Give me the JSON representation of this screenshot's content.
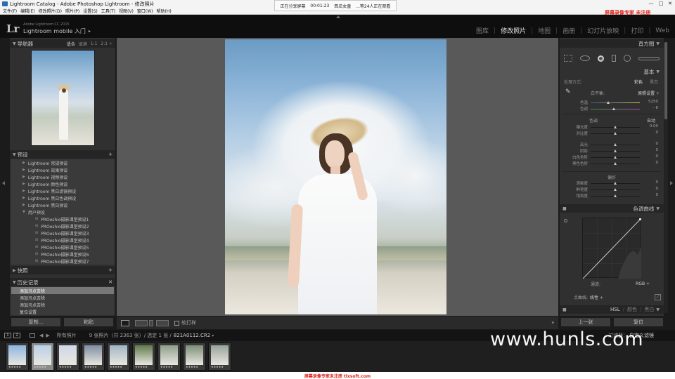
{
  "window": {
    "title": "Lightroom Catalog - Adobe Photoshop Lightroom - 修改照片",
    "minimize": "—",
    "maximize": "□",
    "close": "✕"
  },
  "menu": [
    "文件(F)",
    "编辑(E)",
    "修改照片(D)",
    "照片(P)",
    "设置(S)",
    "工具(T)",
    "视图(V)",
    "窗口(W)",
    "帮助(H)"
  ],
  "share": {
    "status": "正在分享屏幕",
    "time": "00:01:23",
    "host": "西瓜女童",
    "viewers": "...等24人正在观看"
  },
  "watermark_top": "屏幕录像专家 未注册",
  "identity": {
    "logo": "Lr",
    "product": "Adobe Lightroom CC 2015",
    "tagline": "Lightroom mobile 入门",
    "arrow": "▸"
  },
  "modules": [
    {
      "label": "图库",
      "active": false
    },
    {
      "label": "修改照片",
      "active": true
    },
    {
      "label": "地图",
      "active": false
    },
    {
      "label": "画册",
      "active": false
    },
    {
      "label": "幻灯片放映",
      "active": false
    },
    {
      "label": "打印",
      "active": false
    },
    {
      "label": "Web",
      "active": false
    }
  ],
  "navigator": {
    "title": "导航器",
    "zoom_options": [
      "适合",
      "填满",
      "1:1",
      "2:1 ÷"
    ]
  },
  "presets": {
    "title": "预设",
    "add": "+",
    "items": [
      {
        "label": "Lightroom 常规预设",
        "child": false
      },
      {
        "label": "Lightroom 效果预设",
        "child": false
      },
      {
        "label": "Lightroom 视频预设",
        "child": false
      },
      {
        "label": "Lightroom 颜色预设",
        "child": false
      },
      {
        "label": "Lightroom 黑白滤镜预设",
        "child": false
      },
      {
        "label": "Lightroom 黑白色调预设",
        "child": false
      },
      {
        "label": "Lightroom 黑白预设",
        "child": false
      },
      {
        "label": "用户预设",
        "child": false
      },
      {
        "label": "PROoshio摄影课堂预设1",
        "child": true
      },
      {
        "label": "PROoshio摄影课堂预设2",
        "child": true
      },
      {
        "label": "PROoshio摄影课堂预设3",
        "child": true
      },
      {
        "label": "PROoshio摄影课堂预设4",
        "child": true
      },
      {
        "label": "PROoshio摄影课堂预设5",
        "child": true
      },
      {
        "label": "PROoshio摄影课堂预设6",
        "child": true
      },
      {
        "label": "PROoshio摄影课堂预设7",
        "child": true
      }
    ]
  },
  "snapshots": {
    "title": "快照",
    "add": "+"
  },
  "history": {
    "title": "历史记录",
    "close": "✕",
    "items": [
      {
        "label": "添加污点去除",
        "active": true
      },
      {
        "label": "添加污点去除",
        "active": false
      },
      {
        "label": "添加污点去除",
        "active": false
      },
      {
        "label": "复位设置",
        "active": false
      }
    ]
  },
  "left_buttons": {
    "copy": "复制...",
    "paste": "粘贴"
  },
  "histogram": {
    "title": "直方图"
  },
  "basic": {
    "title": "基本",
    "treatment_label": "处理方式:",
    "color": "彩色",
    "bw": "黑白",
    "wb_label": "白平衡:",
    "wb_value": "原照设置 ÷",
    "temp_label": "色温",
    "temp_value": "5250",
    "temp_pos": 0.35,
    "tint_label": "色调",
    "tint_value": "- 6",
    "tint_pos": 0.47,
    "tone_label": "色调",
    "auto": "自动",
    "tone_sliders": [
      {
        "label": "曝光度",
        "value": "0.00",
        "pos": 0.5
      },
      {
        "label": "对比度",
        "value": "0",
        "pos": 0.5
      }
    ],
    "tone_sliders2": [
      {
        "label": "高光",
        "value": "0",
        "pos": 0.5
      },
      {
        "label": "阴影",
        "value": "0",
        "pos": 0.5
      },
      {
        "label": "白色色阶",
        "value": "0",
        "pos": 0.5
      },
      {
        "label": "黑色色阶",
        "value": "0",
        "pos": 0.5
      }
    ],
    "presence_label": "偏好",
    "presence_sliders": [
      {
        "label": "清晰度",
        "value": "0",
        "pos": 0.5
      },
      {
        "label": "鲜艳度",
        "value": "0",
        "pos": 0.5
      },
      {
        "label": "饱和度",
        "value": "0",
        "pos": 0.5
      }
    ]
  },
  "tone_curve": {
    "title": "色调曲线",
    "channel_label": "通道:",
    "channel_value": "RGB ÷",
    "point_curve_label": "点曲线:",
    "point_curve_value": "线性 ÷"
  },
  "hsl": {
    "tabs": [
      "HSL",
      "颜色",
      "黑白"
    ]
  },
  "right_buttons": {
    "prev": "上一张",
    "reset": "复位"
  },
  "toolbar": {
    "softproof": "软打样",
    "expand": "▾"
  },
  "filmbar": {
    "pages": [
      "1",
      "2"
    ],
    "source": "所有照片",
    "count": "9 张照片（共 2363 张）/ 选定 1 张 /",
    "filename": "821A0112.CR2",
    "filter_label": "过滤器：",
    "filter_value": "自定义滤镜"
  },
  "thumbnails": [
    {
      "stars": "★★★★★",
      "selected": false,
      "tone": "#8cb5de"
    },
    {
      "stars": "★★★★★",
      "selected": true,
      "tone": "#b9d0e6"
    },
    {
      "stars": "★★★★★",
      "selected": false,
      "tone": "#cfd8e6"
    },
    {
      "stars": "★★★★★",
      "selected": false,
      "tone": "#7e8da0"
    },
    {
      "stars": "★★★★★",
      "selected": false,
      "tone": "#a2b6c4"
    },
    {
      "stars": "★★★★★",
      "selected": false,
      "tone": "#5f7a4e"
    },
    {
      "stars": "★★★★★",
      "selected": false,
      "tone": "#8ea08a"
    },
    {
      "stars": "★★★★★",
      "selected": false,
      "tone": "#7b8f76"
    },
    {
      "stars": "★★★★★",
      "selected": false,
      "tone": "#98a39a"
    }
  ],
  "hunls": "www.hunls.com",
  "bottom_watermark": "屏幕录像专家未注册  tlxsoft.com",
  "colors": {
    "accent_red": "#e0241b",
    "panel": "#303030",
    "center_bg": "#595959"
  }
}
